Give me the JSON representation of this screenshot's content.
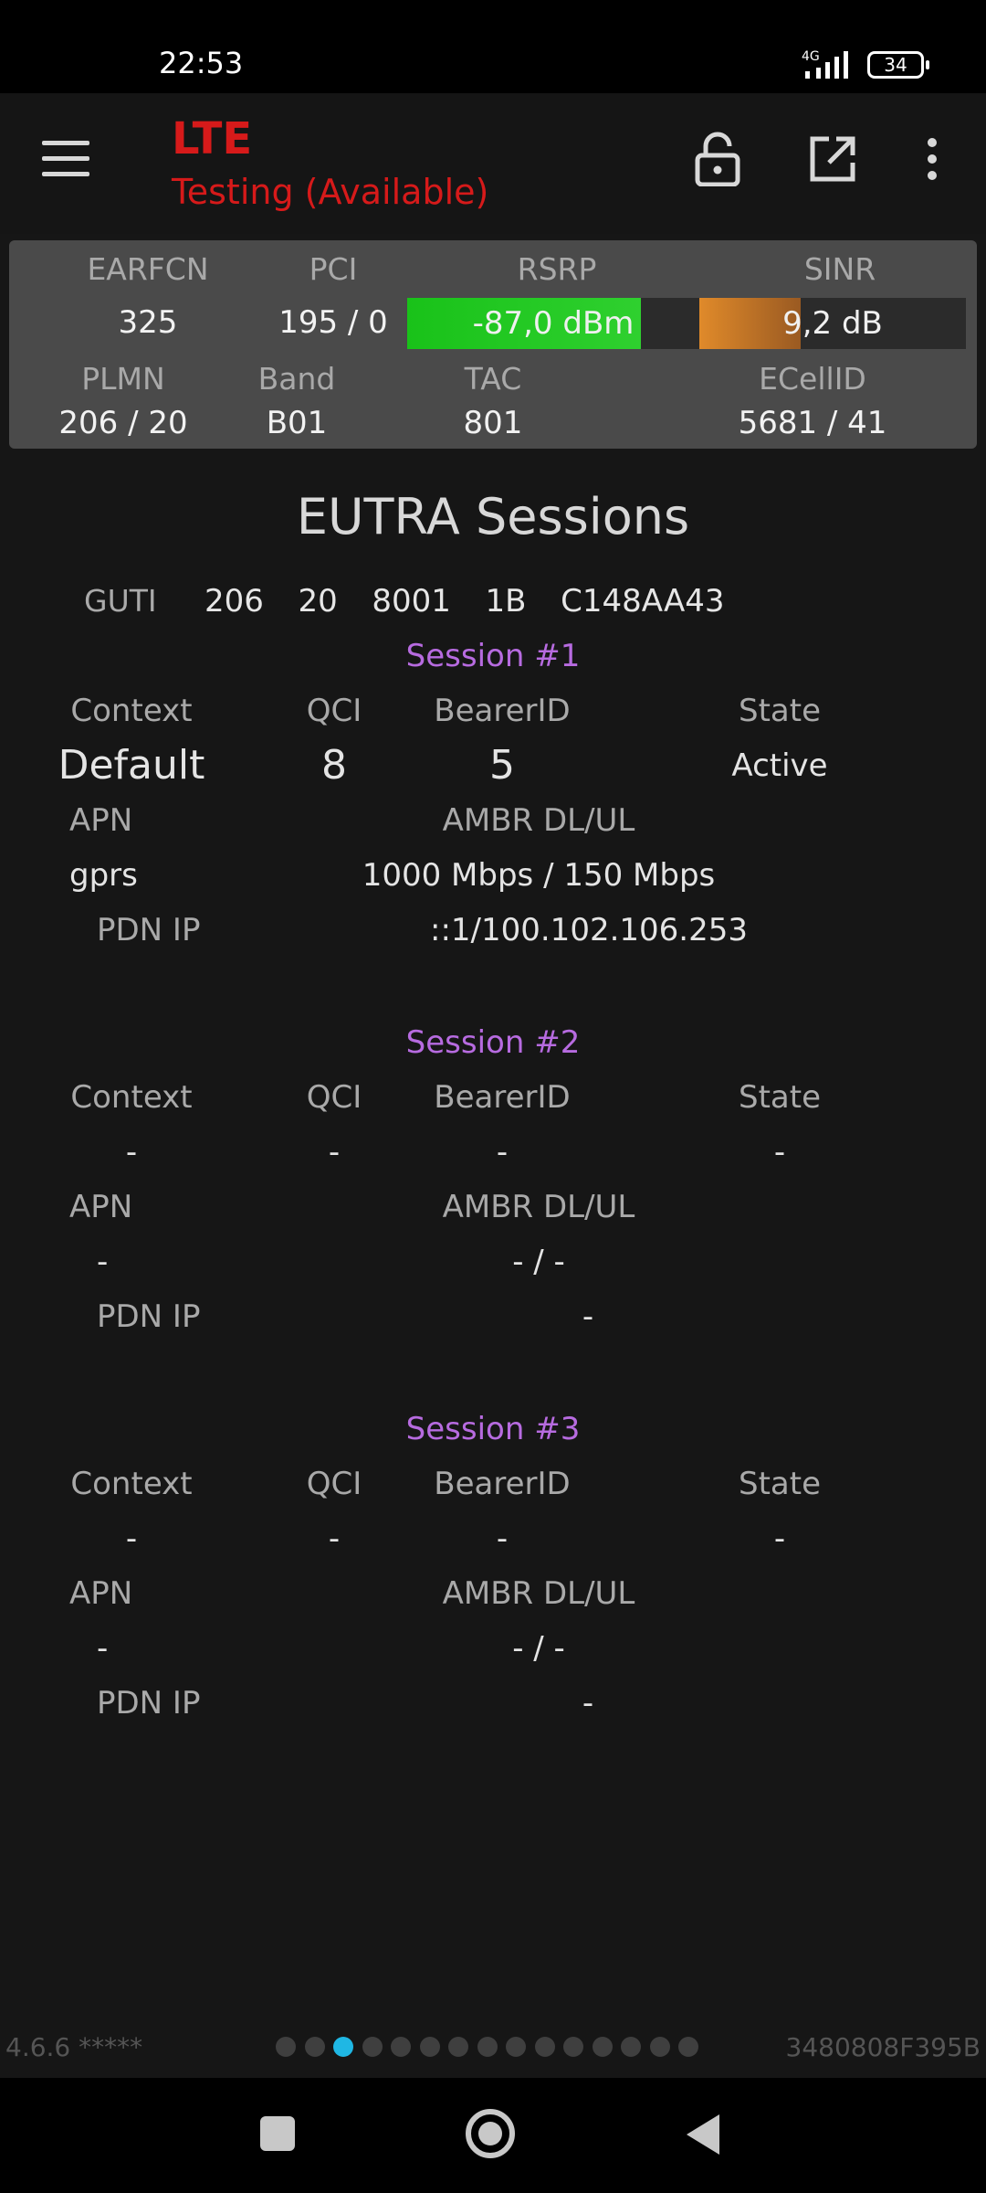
{
  "status_bar": {
    "time": "22:53",
    "network": "4G",
    "battery": "34"
  },
  "app_bar": {
    "title": "LTE",
    "subtitle": "Testing (Available)"
  },
  "cell": {
    "earfcn_label": "EARFCN",
    "earfcn": "325",
    "pci_label": "PCI",
    "pci": "195 / 0",
    "rsrp_label": "RSRP",
    "rsrp": "-87,0 dBm",
    "rsrp_level": 0.8,
    "rsrp_color": "#2fd02f",
    "sinr_label": "SINR",
    "sinr": "9,2 dB",
    "sinr_level": 0.38,
    "sinr_color": "#e08a2a",
    "plmn_label": "PLMN",
    "plmn": "206 / 20",
    "band_label": "Band",
    "band": "B01",
    "tac_label": "TAC",
    "tac": "801",
    "ecellid_label": "ECellID",
    "ecellid": "5681 / 41"
  },
  "eutra": {
    "title": "EUTRA Sessions",
    "guti_label": "GUTI",
    "guti": "206  20  8001  1B  C148AA43",
    "labels": {
      "context": "Context",
      "qci": "QCI",
      "bearer": "BearerID",
      "state": "State",
      "apn": "APN",
      "ambr": "AMBR DL/UL",
      "pdn_ip": "PDN IP"
    },
    "sessions": [
      {
        "title": "Session #1",
        "context": "Default",
        "qci": "8",
        "bearer": "5",
        "state": "Active",
        "apn": "gprs",
        "ambr": "1000 Mbps / 150 Mbps",
        "pdn_ip": "::1/100.102.106.253"
      },
      {
        "title": "Session #2",
        "context": "-",
        "qci": "-",
        "bearer": "-",
        "state": "-",
        "apn": "-",
        "ambr": "- / -",
        "pdn_ip": "-"
      },
      {
        "title": "Session #3",
        "context": "-",
        "qci": "-",
        "bearer": "-",
        "state": "-",
        "apn": "-",
        "ambr": "- / -",
        "pdn_ip": "-"
      }
    ]
  },
  "footer": {
    "version": "4.6.6 *****",
    "device_id": "3480808F395B",
    "page_count": 15,
    "active_page": 3,
    "accent_color": "#1fb7e4"
  }
}
